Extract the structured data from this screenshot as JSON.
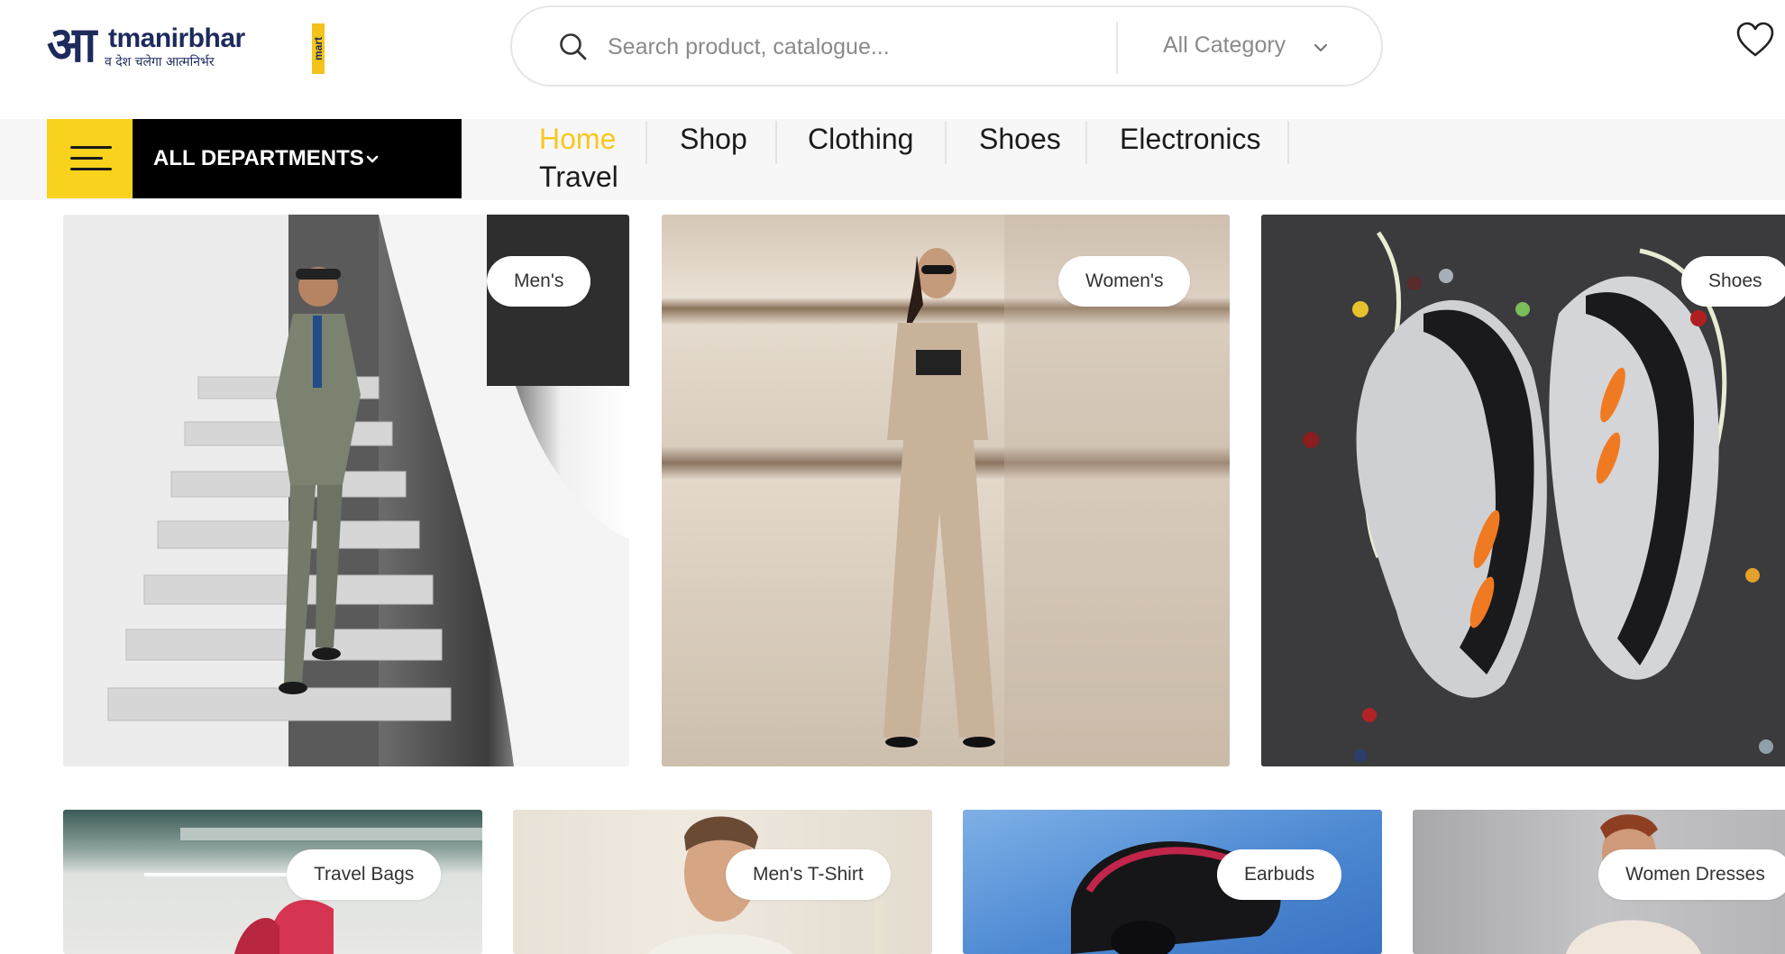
{
  "logo": {
    "big_letter": "आ",
    "wordmark": "tmanirbhar",
    "tagline": "व देश चलेगा आत्मनिर्भर",
    "vertical": "mart"
  },
  "search": {
    "placeholder": "Search product, catalogue...",
    "category": "All Category"
  },
  "departments": {
    "label": "ALL DEPARTMENTS"
  },
  "nav": {
    "items": [
      {
        "label": "Home",
        "active": true
      },
      {
        "label": "Shop"
      },
      {
        "label": "Clothing"
      },
      {
        "label": "Shoes"
      },
      {
        "label": "Electronics"
      },
      {
        "label": "Travel"
      }
    ]
  },
  "categories": {
    "top": [
      {
        "label": "Men's"
      },
      {
        "label": "Women's"
      },
      {
        "label": "Shoes"
      }
    ],
    "bottom": [
      {
        "label": "Travel Bags"
      },
      {
        "label": "Men's T-Shirt"
      },
      {
        "label": "Earbuds"
      },
      {
        "label": "Women Dresses"
      }
    ]
  },
  "colors": {
    "accent": "#f8d21c",
    "nav_active": "#f8c81c",
    "dept_bg": "#000000",
    "brand_navy": "#1c2a5c"
  },
  "icons": {
    "search": "search-icon",
    "category_chevron": "chevron-down-icon",
    "wishlist": "heart-icon",
    "menu": "hamburger-icon"
  }
}
